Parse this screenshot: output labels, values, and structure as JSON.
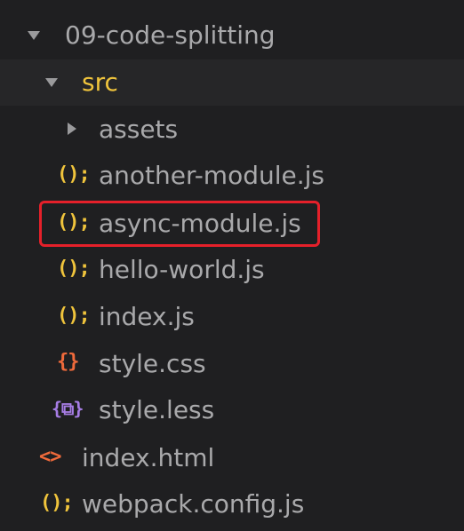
{
  "tree": {
    "root_folder": {
      "label": "09-code-splitting",
      "icon": "chevron-down-icon"
    },
    "src_folder": {
      "label": "src",
      "icon": "chevron-down-icon"
    },
    "assets_folder": {
      "label": "assets",
      "icon": "chevron-right-icon"
    },
    "files": [
      {
        "label": "another-module.js",
        "icon": "js-icon",
        "glyph": "();"
      },
      {
        "label": "async-module.js",
        "icon": "js-icon",
        "glyph": "();"
      },
      {
        "label": "hello-world.js",
        "icon": "js-icon",
        "glyph": "();"
      },
      {
        "label": "index.js",
        "icon": "js-icon",
        "glyph": "();"
      },
      {
        "label": "style.css",
        "icon": "css-icon",
        "glyph": "{}"
      },
      {
        "label": "style.less",
        "icon": "less-icon",
        "glyph": "{⧉}"
      }
    ],
    "root_files": [
      {
        "label": "index.html",
        "icon": "html-icon",
        "glyph": "<>"
      },
      {
        "label": "webpack.config.js",
        "icon": "js-icon",
        "glyph": "();"
      }
    ],
    "highlighted_file": "async-module.js"
  },
  "colors": {
    "background": "#1f1f21",
    "selected_row": "#262628",
    "text": "#a9a9ab",
    "folder_open": "#f0c43c",
    "js_icon": "#f0c43c",
    "css_icon": "#f06a3b",
    "html_icon": "#f06a3b",
    "less_icon": "#a77de6",
    "highlight_border": "#e5202a"
  }
}
